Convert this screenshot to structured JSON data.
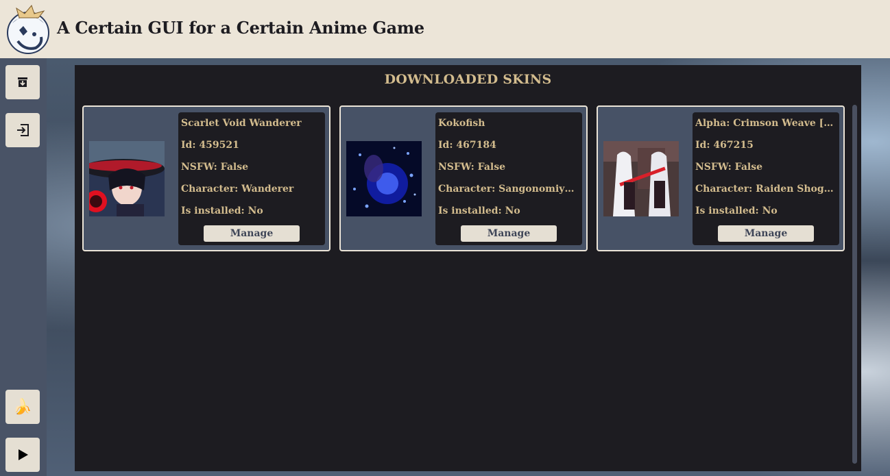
{
  "app": {
    "title": "A Certain GUI for a Certain Anime Game",
    "logo_icon": "paimon-logo-icon"
  },
  "sidebar": {
    "top_items": [
      {
        "icon": "download-box-icon"
      },
      {
        "icon": "login-arrow-icon"
      }
    ],
    "bottom_items": [
      {
        "icon": "banana-icon",
        "glyph": "🍌"
      },
      {
        "icon": "play-icon",
        "glyph": "▶"
      }
    ]
  },
  "panel": {
    "title": "DOWNLOADED SKINS"
  },
  "skins": [
    {
      "name": "Scarlet Void Wanderer",
      "id": "Id: 459521",
      "nsfw": "NSFW: False",
      "character": "Character: Wanderer",
      "installed": "Is installed: No",
      "manage_label": "Manage",
      "thumb_icon": "wanderer-skin-thumbnail"
    },
    {
      "name": "Kokofish",
      "id": "Id: 467184",
      "nsfw": "NSFW: False",
      "character": "Character: Sangonomiya Kokomi",
      "installed": "Is installed: No",
      "manage_label": "Manage",
      "thumb_icon": "kokomi-skin-thumbnail"
    },
    {
      "name": "Alpha: Crimson Weave [Raiden Shogun]",
      "id": "Id: 467215",
      "nsfw": "NSFW: False",
      "character": "Character: Raiden Shogun",
      "installed": "Is installed: No",
      "manage_label": "Manage",
      "thumb_icon": "raiden-skin-thumbnail"
    }
  ],
  "colors": {
    "header_bg": "#ece5d8",
    "sidebar_bg": "#495366",
    "panel_bg": "#1d1c21",
    "card_bg": "#475266",
    "accent_gold": "#d3bc8e",
    "button_bg": "#e5dfd3"
  }
}
